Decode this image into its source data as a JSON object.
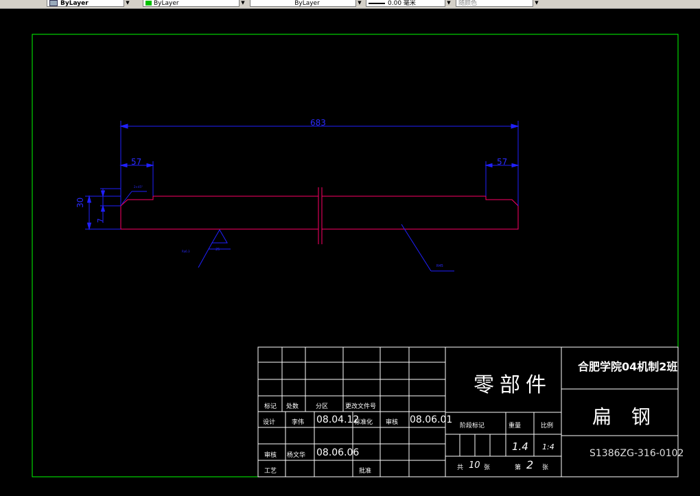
{
  "toolbar": {
    "icon": "layer-icon",
    "combo1": "ByLayer",
    "color_combo": "ByLayer",
    "linetype_combo": "ByLayer",
    "lineweight_combo": "0.00 毫米",
    "plotstyle_combo": "随颜色"
  },
  "colors": {
    "frame": "#00ff00",
    "geometry": "#ff0066",
    "dimension": "#2020ff",
    "table": "#ffffff",
    "background": "#000000"
  },
  "drawing": {
    "dims": {
      "overall": "683",
      "left_step": "57",
      "right_step": "57",
      "height": "30",
      "step_height": "7"
    },
    "tiny_labels": {
      "chamfer": "2×45°",
      "left_leader": "Ra6.3",
      "triangle": "25",
      "right_leader": "R45"
    }
  },
  "title_block": {
    "revision_headers": [
      "标记",
      "处数",
      "分区",
      "更改文件号"
    ],
    "design_label": "设计",
    "designer": "李伟",
    "design_date": "08.04.12",
    "standard_label": "标准化",
    "review_label": "审核",
    "reviewer": "杨文华",
    "review_date": "08.06.06",
    "process_label": "工艺",
    "approve_label": "批准",
    "check_label": "审核",
    "check_date": "08.06.01",
    "stage_label": "阶段标记",
    "weight_label": "重量",
    "scale_label": "比例",
    "weight_value": "1.4",
    "scale_value": "1:4",
    "total_sheets_label": "共",
    "total_sheets": "10",
    "sheet_unit": "张",
    "sheet_label": "第",
    "sheet_number": "2",
    "sheet_unit2": "张",
    "part_type": "零部件",
    "school": "合肥学院04机制2班",
    "part_name": "扁 钢",
    "drawing_number": "S1386ZG-316-0102"
  }
}
